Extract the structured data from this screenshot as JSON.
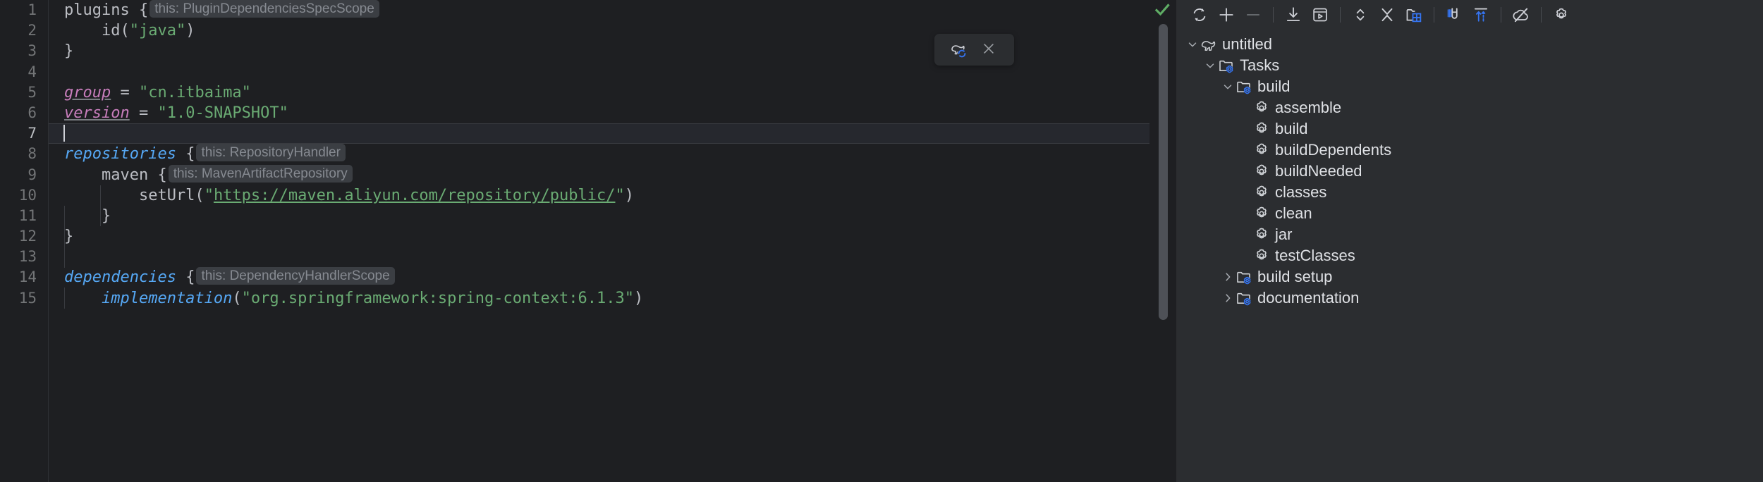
{
  "editor": {
    "line_numbers": [
      "1",
      "2",
      "3",
      "4",
      "5",
      "6",
      "7",
      "8",
      "9",
      "10",
      "11",
      "12",
      "13",
      "14",
      "15"
    ],
    "current_line": 7,
    "lines": [
      {
        "n": 1,
        "segments": [
          {
            "t": "plugins ",
            "c": "plain"
          },
          {
            "t": "{",
            "c": "plain"
          },
          {
            "t": "this: PluginDependenciesSpecScope",
            "c": "hint"
          }
        ]
      },
      {
        "n": 2,
        "segments": [
          {
            "t": "    id(",
            "c": "plain"
          },
          {
            "t": "\"java\"",
            "c": "str"
          },
          {
            "t": ")",
            "c": "plain"
          }
        ]
      },
      {
        "n": 3,
        "segments": [
          {
            "t": "}",
            "c": "plain"
          }
        ]
      },
      {
        "n": 4,
        "segments": []
      },
      {
        "n": 5,
        "segments": [
          {
            "t": "group",
            "c": "prop"
          },
          {
            "t": " = ",
            "c": "plain"
          },
          {
            "t": "\"cn.itbaima\"",
            "c": "str"
          }
        ]
      },
      {
        "n": 6,
        "segments": [
          {
            "t": "version",
            "c": "prop"
          },
          {
            "t": " = ",
            "c": "plain"
          },
          {
            "t": "\"1.0-SNAPSHOT\"",
            "c": "str"
          }
        ]
      },
      {
        "n": 7,
        "segments": [
          {
            "t": "",
            "c": "caret"
          }
        ]
      },
      {
        "n": 8,
        "segments": [
          {
            "t": "repositories",
            "c": "fn"
          },
          {
            "t": " {",
            "c": "plain"
          },
          {
            "t": "this: RepositoryHandler",
            "c": "hint"
          }
        ]
      },
      {
        "n": 9,
        "segments": [
          {
            "t": "    maven {",
            "c": "plain"
          },
          {
            "t": "this: MavenArtifactRepository",
            "c": "hint"
          }
        ]
      },
      {
        "n": 10,
        "segments": [
          {
            "t": "        setUrl(",
            "c": "plain"
          },
          {
            "t": "\"",
            "c": "str"
          },
          {
            "t": "https://maven.aliyun.com/repository/public/",
            "c": "link"
          },
          {
            "t": "\"",
            "c": "str"
          },
          {
            "t": ")",
            "c": "plain"
          }
        ]
      },
      {
        "n": 11,
        "segments": [
          {
            "t": "    }",
            "c": "plain"
          }
        ]
      },
      {
        "n": 12,
        "segments": [
          {
            "t": "}",
            "c": "plain"
          }
        ]
      },
      {
        "n": 13,
        "segments": []
      },
      {
        "n": 14,
        "segments": [
          {
            "t": "dependencies",
            "c": "fn"
          },
          {
            "t": " {",
            "c": "plain"
          },
          {
            "t": "this: DependencyHandlerScope",
            "c": "hint"
          }
        ]
      },
      {
        "n": 15,
        "segments": [
          {
            "t": "    implementation",
            "c": "fn"
          },
          {
            "t": "(",
            "c": "plain"
          },
          {
            "t": "\"org.springframework:spring-context:6.1.3\"",
            "c": "str"
          },
          {
            "t": ")",
            "c": "plain"
          }
        ]
      }
    ],
    "inlay_hints": [
      "this: PluginDependenciesSpecScope",
      "this: RepositoryHandler",
      "this: MavenArtifactRepository",
      "this: DependencyHandlerScope"
    ],
    "reload_widget": {
      "gradle_reload_tooltip": "Load Gradle Changes",
      "close_tooltip": "Close"
    },
    "status_icon": "checkmark-icon",
    "colors": {
      "background": "#1e1f22",
      "string": "#6aab73",
      "function": "#56a8f5",
      "property": "#c77dbb",
      "text": "#bcbec4",
      "line_number": "#737577",
      "hint_pill_bg": "#3b3e43",
      "accent_blue": "#3574f0",
      "status_green": "#5fad65",
      "highlight_red": "#fe0000"
    }
  },
  "toolwindow": {
    "title": "Gradle",
    "toolbar": [
      {
        "name": "reload-all-gradle-projects-button",
        "icon": "refresh-icon",
        "label": "Reload All Gradle Projects"
      },
      {
        "name": "add-button",
        "icon": "plus-icon",
        "label": "Link Gradle Project"
      },
      {
        "name": "remove-button",
        "icon": "minus-icon",
        "label": "Detach Gradle Project"
      },
      {
        "name": "separator-1",
        "icon": "separator",
        "label": ""
      },
      {
        "name": "download-sources-button",
        "icon": "download-icon",
        "label": "Download Sources"
      },
      {
        "name": "run-task-button",
        "icon": "run-window-icon",
        "label": "Execute Gradle Task"
      },
      {
        "name": "separator-2",
        "icon": "separator",
        "label": ""
      },
      {
        "name": "expand-collapse-button",
        "icon": "expand-collapse-icon",
        "label": "Expand All"
      },
      {
        "name": "collapse-all-button",
        "icon": "collapse-all-icon",
        "label": "Collapse All"
      },
      {
        "name": "open-gradle-config-button",
        "icon": "folder-grid-icon",
        "label": "Open Gradle Config"
      },
      {
        "name": "separator-3",
        "icon": "separator",
        "label": ""
      },
      {
        "name": "toggle-tasks-button",
        "icon": "magnet-icon",
        "label": "Toggle Tasks"
      },
      {
        "name": "sync-button",
        "icon": "arrows-up-icon",
        "label": "Sync"
      },
      {
        "name": "separator-4",
        "icon": "separator",
        "label": ""
      },
      {
        "name": "offline-mode-button",
        "icon": "cloud-off-icon",
        "label": "Toggle Offline Mode"
      },
      {
        "name": "separator-5",
        "icon": "separator",
        "label": ""
      },
      {
        "name": "gradle-settings-button",
        "icon": "gear-icon",
        "label": "Gradle Settings"
      }
    ],
    "tree": [
      {
        "label": "untitled",
        "depth": 0,
        "chevron": "down",
        "icon": "gradle-elephant-icon",
        "highlighted": false
      },
      {
        "label": "Tasks",
        "depth": 1,
        "chevron": "down",
        "icon": "folder-gear-icon",
        "highlighted": false
      },
      {
        "label": "build",
        "depth": 2,
        "chevron": "down",
        "icon": "folder-gear-icon",
        "highlighted": false
      },
      {
        "label": "assemble",
        "depth": 3,
        "chevron": "none",
        "icon": "gear-task-icon",
        "highlighted": true
      },
      {
        "label": "build",
        "depth": 3,
        "chevron": "none",
        "icon": "gear-task-icon",
        "highlighted": true
      },
      {
        "label": "buildDependents",
        "depth": 3,
        "chevron": "none",
        "icon": "gear-task-icon",
        "highlighted": true
      },
      {
        "label": "buildNeeded",
        "depth": 3,
        "chevron": "none",
        "icon": "gear-task-icon",
        "highlighted": true
      },
      {
        "label": "classes",
        "depth": 3,
        "chevron": "none",
        "icon": "gear-task-icon",
        "highlighted": true
      },
      {
        "label": "clean",
        "depth": 3,
        "chevron": "none",
        "icon": "gear-task-icon",
        "highlighted": true
      },
      {
        "label": "jar",
        "depth": 3,
        "chevron": "none",
        "icon": "gear-task-icon",
        "highlighted": true
      },
      {
        "label": "testClasses",
        "depth": 3,
        "chevron": "none",
        "icon": "gear-task-icon",
        "highlighted": true
      },
      {
        "label": "build setup",
        "depth": 2,
        "chevron": "right",
        "icon": "folder-gear-icon",
        "highlighted": false
      },
      {
        "label": "documentation",
        "depth": 2,
        "chevron": "right",
        "icon": "folder-gear-icon",
        "highlighted": false
      }
    ]
  }
}
